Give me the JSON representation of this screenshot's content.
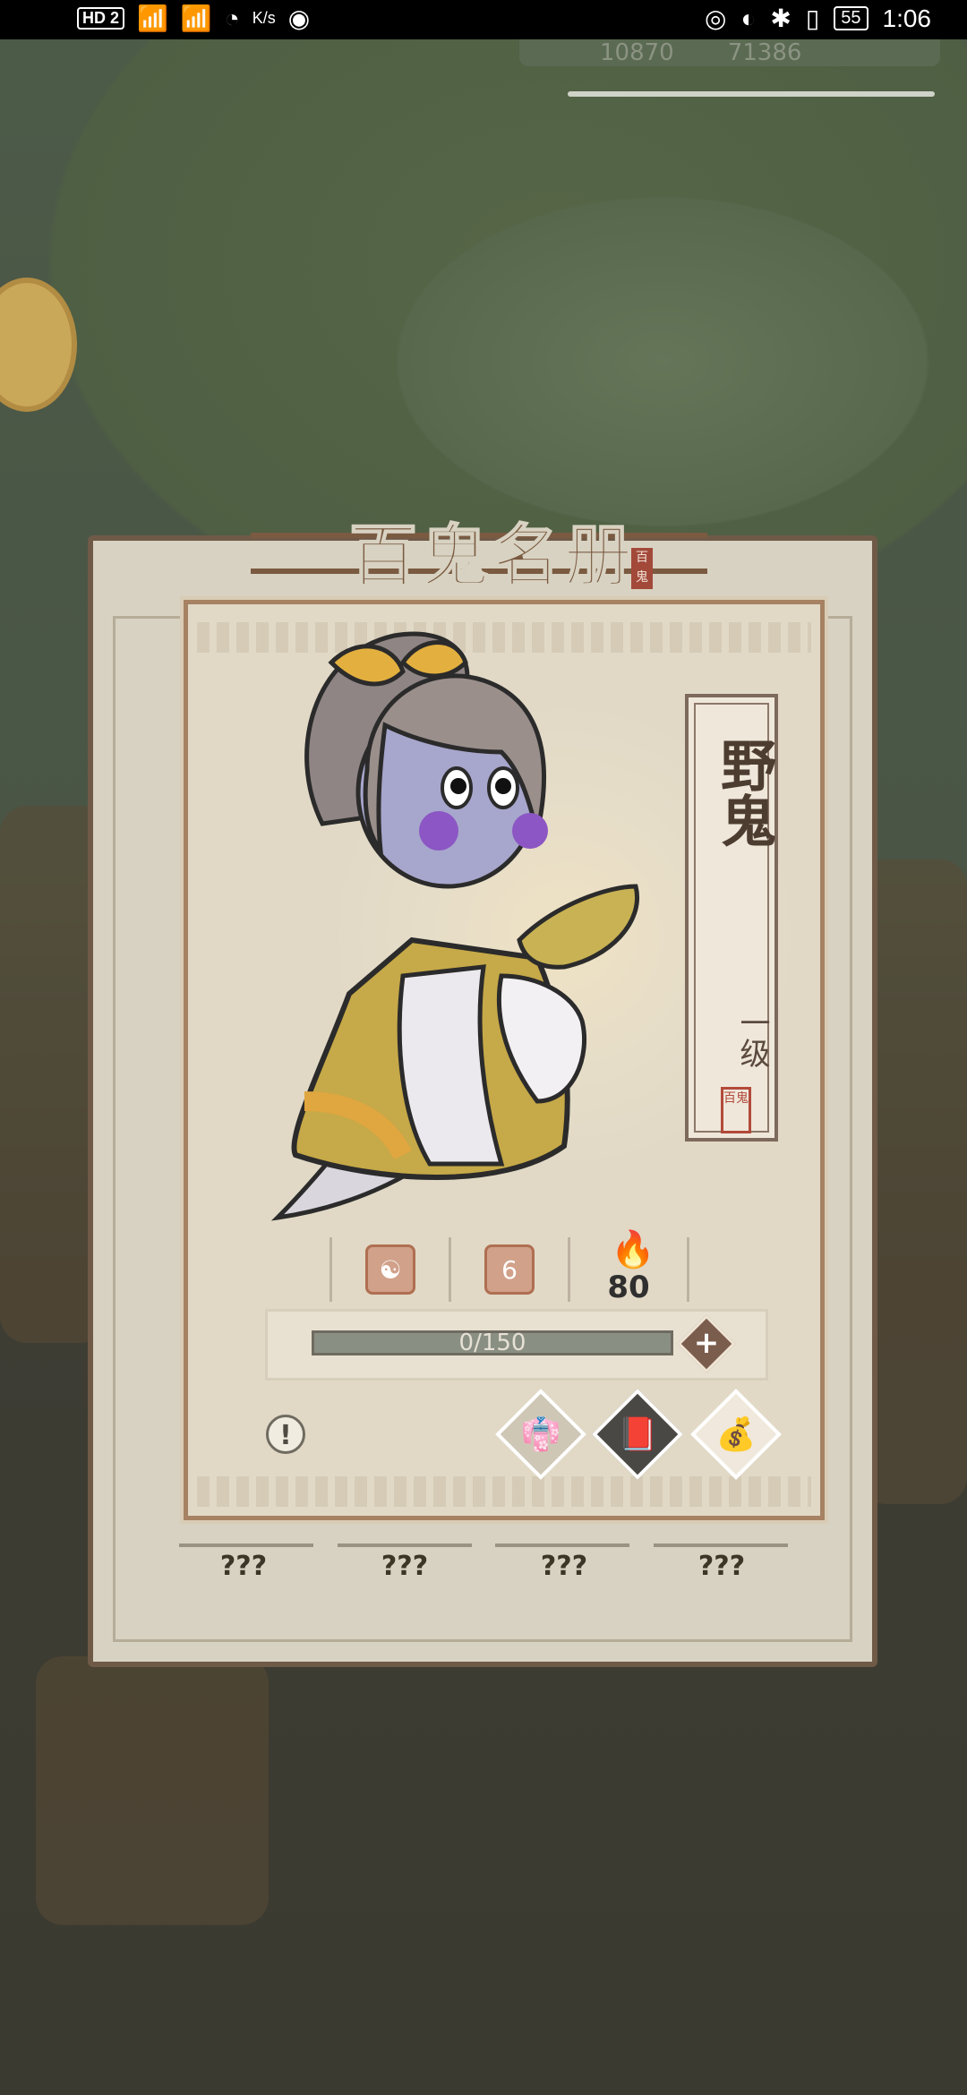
{
  "status_bar": {
    "left_badge": "HD 2",
    "speed_unit": "K/s",
    "battery": "55",
    "time": "1:06"
  },
  "hud": {
    "currency_1": "10870",
    "currency_2": "71386"
  },
  "panel": {
    "title": "百鬼名册",
    "title_seal": "百鬼",
    "bottom_labels": [
      "???",
      "???",
      "???",
      "???"
    ]
  },
  "card": {
    "name": "野鬼",
    "level": "一级",
    "seal": "百鬼",
    "stats": {
      "stat_2_value": "6",
      "stat_3_value": "80"
    },
    "progress": {
      "text": "0/150",
      "current": 0,
      "max": 150
    }
  },
  "icons": {
    "info": "exclamation-icon",
    "plus": "plus-icon",
    "outfit": "robe-icon",
    "book": "book-icon",
    "bag": "treasure-bag-icon"
  },
  "colors": {
    "panel_border": "#6f5a47",
    "card_border": "#a68263",
    "accent": "#7b5d4d"
  }
}
